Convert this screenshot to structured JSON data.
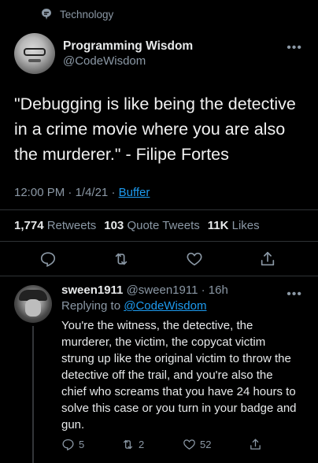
{
  "topic": {
    "icon": "topic-tag-icon",
    "label": "Technology"
  },
  "tweet": {
    "author": {
      "name": "Programming Wisdom",
      "handle": "@CodeWisdom"
    },
    "text": "\"Debugging is like being the detective in a crime movie where you are also the murderer.\" - Filipe Fortes",
    "time": "12:00 PM",
    "date": "1/4/21",
    "source": "Buffer",
    "stats": {
      "retweets": "1,774",
      "retweets_label": "Retweets",
      "quote_tweets": "103",
      "quote_tweets_label": "Quote Tweets",
      "likes": "11K",
      "likes_label": "Likes"
    },
    "actions": [
      "reply-icon",
      "retweet-icon",
      "like-icon",
      "share-icon"
    ]
  },
  "reply": {
    "name": "sween1911",
    "handle": "@sween1911",
    "age": "16h",
    "replying_prefix": "Replying to",
    "replying_to": "@CodeWisdom",
    "text": "You're the witness, the detective, the murderer, the victim, the copycat victim strung up like the original victim to throw the detective off the trail, and you're also the chief who screams that you have 24 hours to solve this case or you turn in your badge and gun.",
    "counts": {
      "replies": "5",
      "retweets": "2",
      "likes": "52"
    }
  },
  "colors": {
    "background": "#000000",
    "text": "#e7e9ea",
    "muted": "#8b98a5",
    "link": "#1d9bf0",
    "divider": "#2f3336"
  }
}
